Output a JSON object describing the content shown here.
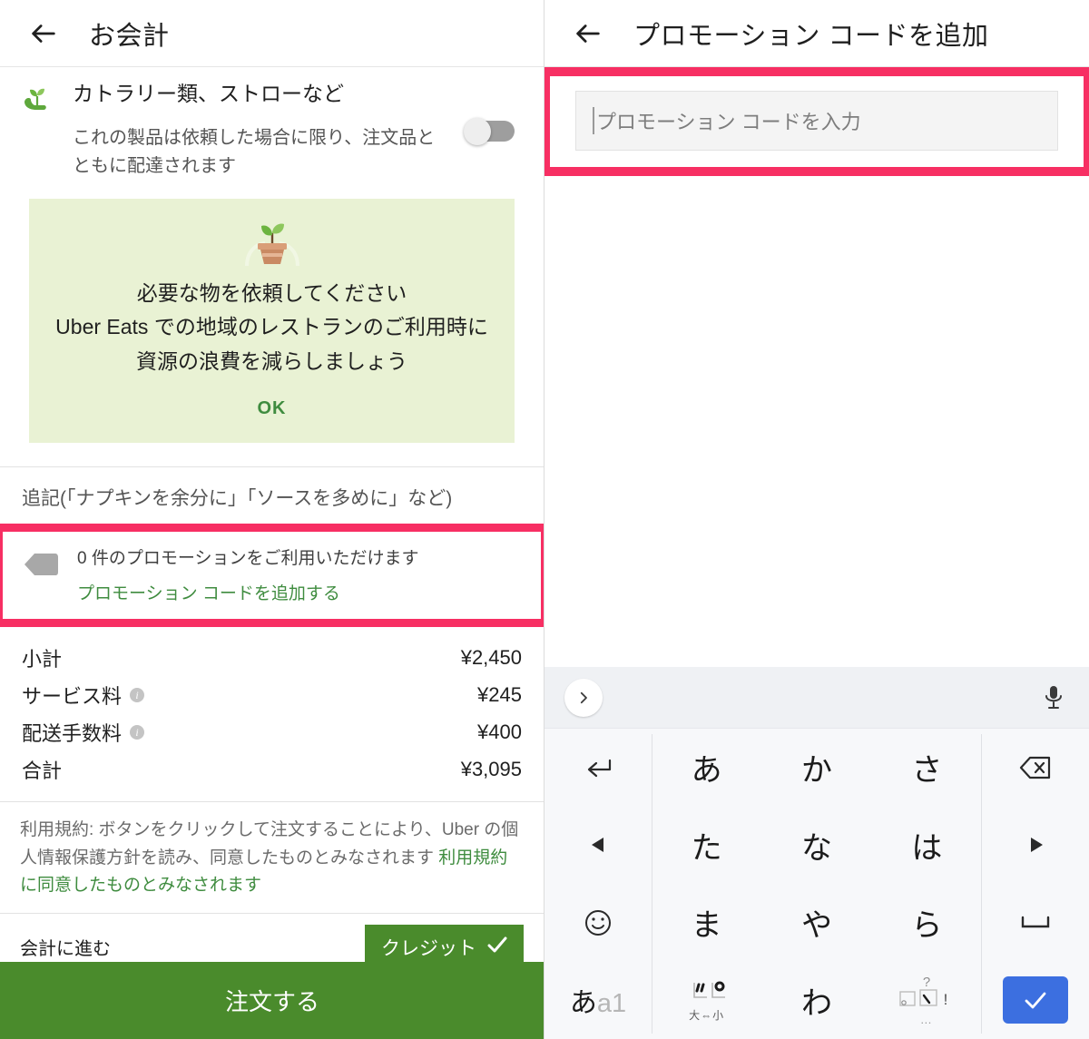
{
  "left": {
    "appbar": {
      "title": "お会計",
      "back_icon": "back-arrow-icon"
    },
    "cutlery": {
      "icon": "sprout-hand-icon",
      "title": "カトラリー類、ストローなど",
      "subtitle": "これの製品は依頼した場合に限り、注文品とともに配達されます",
      "toggle_state": "off"
    },
    "eco_card": {
      "icon": "potted-seedling-icon",
      "line1": "必要な物を依頼してください",
      "line2": "Uber Eats での地域のレストランのご利用時に",
      "line3": "資源の浪費を減らしましょう",
      "ok_label": "OK",
      "bg_color": "#e9f2d4",
      "accent_color": "#3f8c3f"
    },
    "note": "追記(「ナプキンを余分に」「ソースを多めに」など)",
    "promo": {
      "icon": "price-tag-icon",
      "available_text": "0 件のプロモーションをご利用いただけます",
      "add_link": "プロモーション コードを追加する",
      "highlight_color": "#f72f63"
    },
    "prices": {
      "rows": [
        {
          "label": "小計",
          "value": "¥2,450",
          "info": false
        },
        {
          "label": "サービス料",
          "value": "¥245",
          "info": true
        },
        {
          "label": "配送手数料",
          "value": "¥400",
          "info": true
        },
        {
          "label": "合計",
          "value": "¥3,095",
          "info": false
        }
      ]
    },
    "terms": {
      "plain": "利用規約: ボタンをクリックして注文することにより、Uber の個人情報保護方針を読み、同意したものとみなされます ",
      "link": "利用規約に同意したものとみなされます"
    },
    "pay": {
      "label": "会計に進む",
      "method_label": "クレジット",
      "check_icon": "check-icon",
      "button_color": "#4a8b2c"
    },
    "order_button": {
      "label": "注文する",
      "color": "#4a8b2c"
    }
  },
  "right": {
    "appbar": {
      "title": "プロモーション コードを追加",
      "back_icon": "back-arrow-icon"
    },
    "input": {
      "placeholder": "プロモーション コードを入力",
      "value": "",
      "highlight_color": "#f72f63"
    },
    "keyboard": {
      "toolbar": {
        "expand_icon": "chevron-right-icon",
        "mic_icon": "microphone-icon"
      },
      "keys": [
        {
          "name": "key-undo",
          "glyph": "undo-arrow-icon",
          "sub": ""
        },
        {
          "name": "key-a",
          "glyph": "あ",
          "sub": ""
        },
        {
          "name": "key-ka",
          "glyph": "か",
          "sub": ""
        },
        {
          "name": "key-sa",
          "glyph": "さ",
          "sub": ""
        },
        {
          "name": "key-backspace",
          "glyph": "backspace-icon",
          "sub": ""
        },
        {
          "name": "key-left",
          "glyph": "caret-left-icon",
          "sub": ""
        },
        {
          "name": "key-ta",
          "glyph": "た",
          "sub": ""
        },
        {
          "name": "key-na",
          "glyph": "な",
          "sub": ""
        },
        {
          "name": "key-ha",
          "glyph": "は",
          "sub": ""
        },
        {
          "name": "key-right",
          "glyph": "caret-right-icon",
          "sub": ""
        },
        {
          "name": "key-emoji",
          "glyph": "emoji-icon",
          "sub": ""
        },
        {
          "name": "key-ma",
          "glyph": "ま",
          "sub": ""
        },
        {
          "name": "key-ya",
          "glyph": "や",
          "sub": ""
        },
        {
          "name": "key-ra",
          "glyph": "ら",
          "sub": ""
        },
        {
          "name": "key-space",
          "glyph": "space-icon",
          "sub": ""
        },
        {
          "name": "key-mode",
          "glyph": "あa1",
          "sub": ""
        },
        {
          "name": "key-dakuten",
          "glyph": "dakuten-icon",
          "sub": "大⇔小"
        },
        {
          "name": "key-wa",
          "glyph": "わ",
          "sub": ""
        },
        {
          "name": "key-punct",
          "glyph": "punctuation-icon",
          "sub": "…"
        },
        {
          "name": "key-enter",
          "glyph": "check-icon",
          "sub": ""
        }
      ],
      "enter_color": "#3c6fe0"
    }
  }
}
